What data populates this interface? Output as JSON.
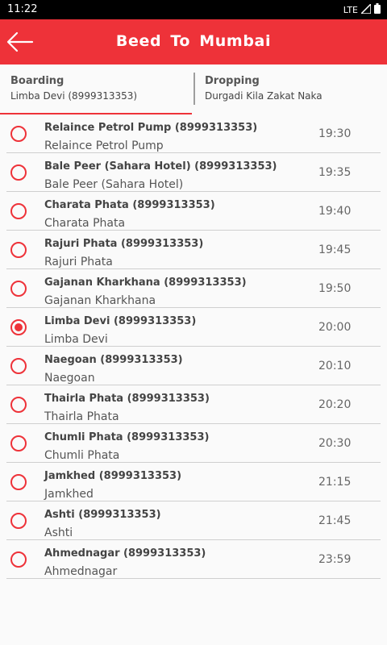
{
  "status_bar": {
    "time": "11:22",
    "network": "LTE"
  },
  "app_bar": {
    "title": "Beed  To  Mumbai"
  },
  "tabs": [
    {
      "label": "Boarding",
      "value": "Limba Devi (8999313353)"
    },
    {
      "label": "Dropping",
      "value": "Durgadi Kila Zakat Naka"
    }
  ],
  "stops": [
    {
      "title": "Relaince Petrol Pump (8999313353)",
      "subtitle": "Relaince Petrol Pump",
      "time": "19:30"
    },
    {
      "title": "Bale Peer (Sahara Hotel) (8999313353)",
      "subtitle": "Bale Peer (Sahara Hotel)",
      "time": "19:35"
    },
    {
      "title": "Charata Phata (8999313353)",
      "subtitle": "Charata Phata",
      "time": "19:40"
    },
    {
      "title": "Rajuri Phata (8999313353)",
      "subtitle": "Rajuri Phata",
      "time": "19:45"
    },
    {
      "title": "Gajanan Kharkhana (8999313353)",
      "subtitle": "Gajanan Kharkhana",
      "time": "19:50"
    },
    {
      "title": "Limba Devi (8999313353)",
      "subtitle": "Limba Devi",
      "time": "20:00"
    },
    {
      "title": "Naegoan (8999313353)",
      "subtitle": "Naegoan",
      "time": "20:10"
    },
    {
      "title": "Thairla Phata (8999313353)",
      "subtitle": "Thairla Phata",
      "time": "20:20"
    },
    {
      "title": "Chumli Phata (8999313353)",
      "subtitle": "Chumli Phata",
      "time": "20:30"
    },
    {
      "title": "Jamkhed (8999313353)",
      "subtitle": "Jamkhed",
      "time": "21:15"
    },
    {
      "title": "Ashti (8999313353)",
      "subtitle": "Ashti",
      "time": "21:45"
    },
    {
      "title": "Ahmednagar (8999313353)",
      "subtitle": "Ahmednagar",
      "time": "23:59"
    }
  ],
  "selected_stop_index": 5,
  "colors": {
    "accent": "#ee3239",
    "status_bar": "#000000",
    "background": "#fafafa"
  },
  "icons": {
    "back": "arrow-left-icon",
    "signal": "signal-icon",
    "battery": "battery-icon"
  }
}
